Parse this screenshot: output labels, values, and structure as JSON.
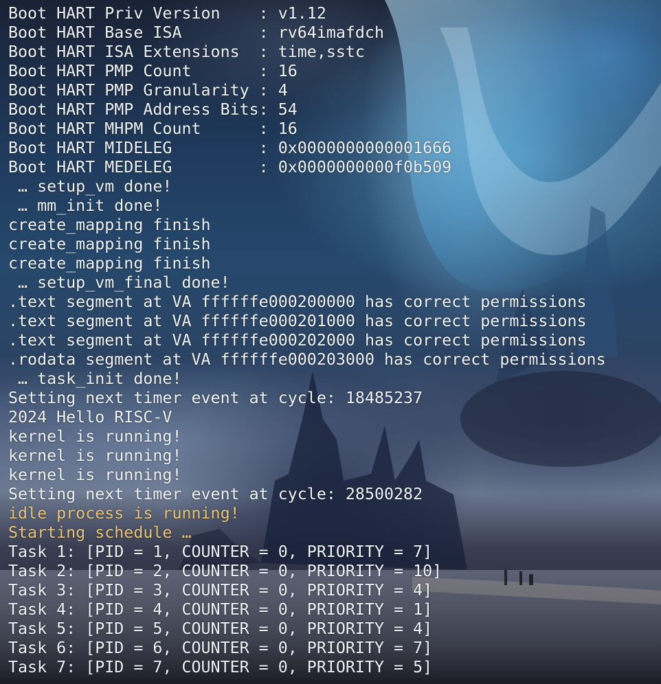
{
  "colors": {
    "text": "#eef2f6",
    "highlight": "#e8c477"
  },
  "lines": [
    {
      "text": "Boot HART Priv Version    : v1.12",
      "style": "normal"
    },
    {
      "text": "Boot HART Base ISA        : rv64imafdch",
      "style": "normal"
    },
    {
      "text": "Boot HART ISA Extensions  : time,sstc",
      "style": "normal"
    },
    {
      "text": "Boot HART PMP Count       : 16",
      "style": "normal"
    },
    {
      "text": "Boot HART PMP Granularity : 4",
      "style": "normal"
    },
    {
      "text": "Boot HART PMP Address Bits: 54",
      "style": "normal"
    },
    {
      "text": "Boot HART MHPM Count      : 16",
      "style": "normal"
    },
    {
      "text": "Boot HART MIDELEG         : 0x0000000000001666",
      "style": "normal"
    },
    {
      "text": "Boot HART MEDELEG         : 0x0000000000f0b509",
      "style": "normal"
    },
    {
      "text": " … setup_vm done!",
      "style": "normal"
    },
    {
      "text": " … mm_init done!",
      "style": "normal"
    },
    {
      "text": "create_mapping finish",
      "style": "normal"
    },
    {
      "text": "create_mapping finish",
      "style": "normal"
    },
    {
      "text": "create_mapping finish",
      "style": "normal"
    },
    {
      "text": " … setup_vm_final done!",
      "style": "normal"
    },
    {
      "text": ".text segment at VA ffffffe000200000 has correct permissions",
      "style": "normal"
    },
    {
      "text": ".text segment at VA ffffffe000201000 has correct permissions",
      "style": "normal"
    },
    {
      "text": ".text segment at VA ffffffe000202000 has correct permissions",
      "style": "normal"
    },
    {
      "text": ".rodata segment at VA ffffffe000203000 has correct permissions",
      "style": "normal"
    },
    {
      "text": " … task_init done!",
      "style": "normal"
    },
    {
      "text": "Setting next timer event at cycle: 18485237",
      "style": "normal"
    },
    {
      "text": "2024 Hello RISC-V",
      "style": "normal"
    },
    {
      "text": "kernel is running!",
      "style": "normal"
    },
    {
      "text": "kernel is running!",
      "style": "normal"
    },
    {
      "text": "kernel is running!",
      "style": "normal"
    },
    {
      "text": "Setting next timer event at cycle: 28500282",
      "style": "normal"
    },
    {
      "text": "idle process is running!",
      "style": "warn"
    },
    {
      "text": "Starting schedule …",
      "style": "warn"
    },
    {
      "text": "Task 1: [PID = 1, COUNTER = 0, PRIORITY = 7]",
      "style": "normal"
    },
    {
      "text": "Task 2: [PID = 2, COUNTER = 0, PRIORITY = 10]",
      "style": "normal"
    },
    {
      "text": "Task 3: [PID = 3, COUNTER = 0, PRIORITY = 4]",
      "style": "normal"
    },
    {
      "text": "Task 4: [PID = 4, COUNTER = 0, PRIORITY = 1]",
      "style": "normal"
    },
    {
      "text": "Task 5: [PID = 5, COUNTER = 0, PRIORITY = 4]",
      "style": "normal"
    },
    {
      "text": "Task 6: [PID = 6, COUNTER = 0, PRIORITY = 7]",
      "style": "normal"
    },
    {
      "text": "Task 7: [PID = 7, COUNTER = 0, PRIORITY = 5]",
      "style": "normal"
    }
  ]
}
